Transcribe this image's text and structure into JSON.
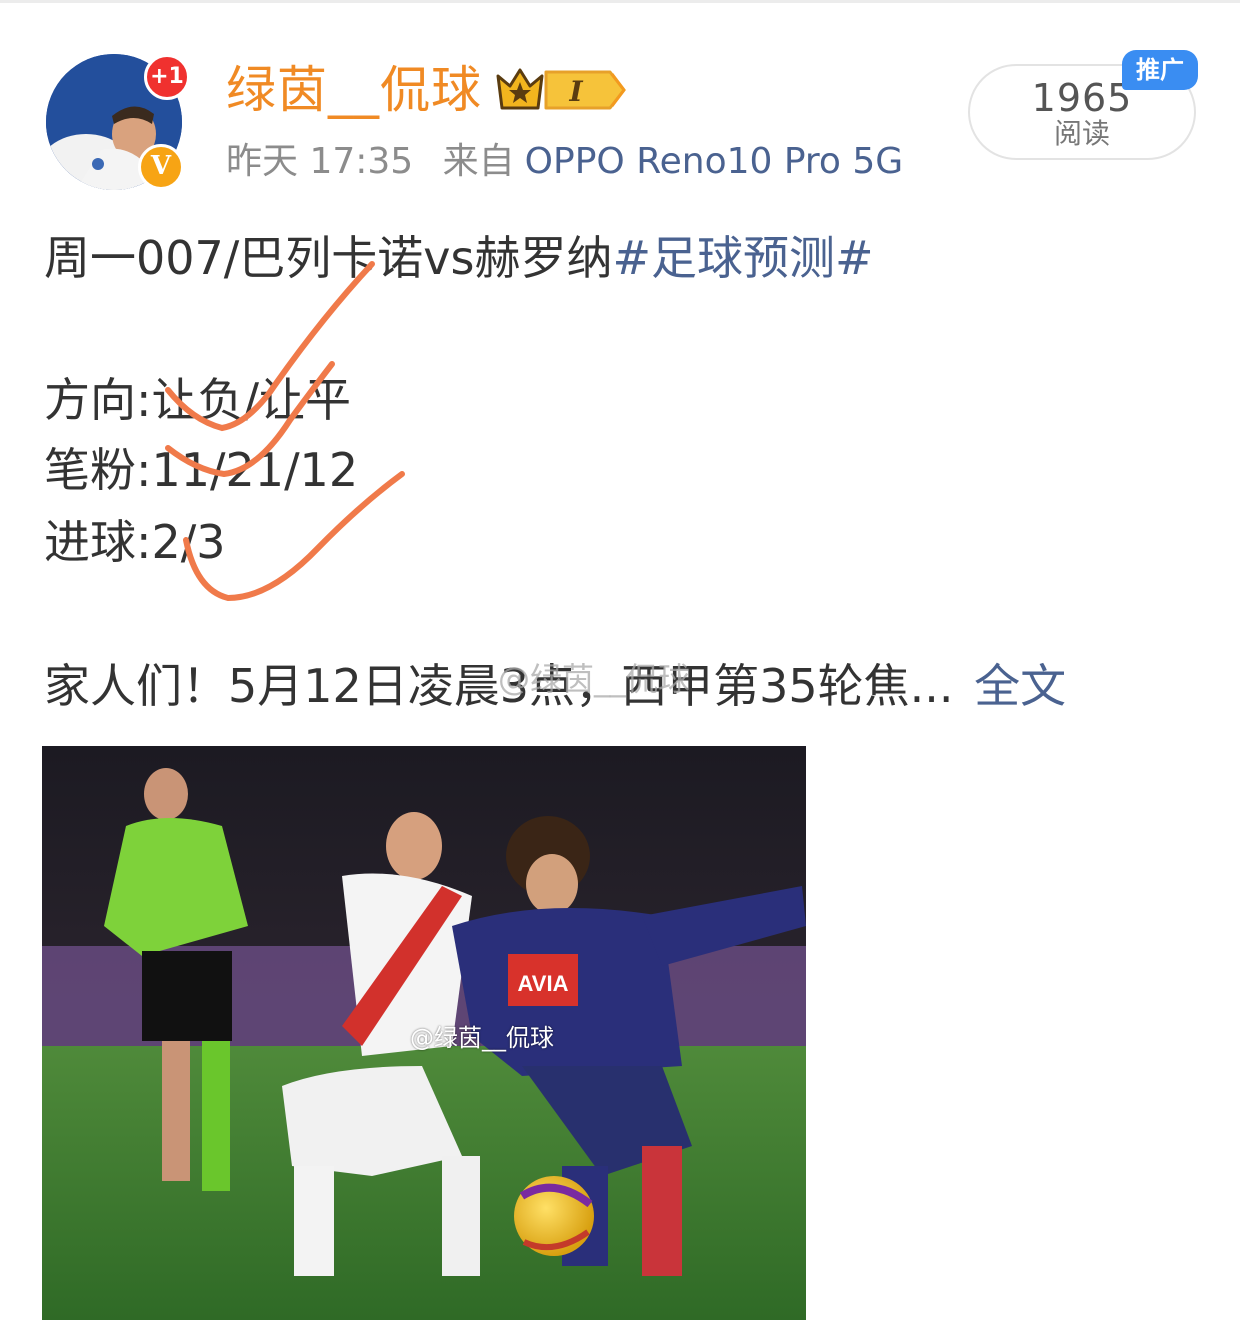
{
  "post": {
    "username": "绿茵__侃球",
    "level_badge": "I",
    "new_count_badge": "+1",
    "verified_badge": "V",
    "time": "昨天 17:35",
    "source_prefix": "来自",
    "source_device": "OPPO Reno10 Pro 5G",
    "reads_count": "1965",
    "reads_label": "阅读",
    "promo_tag": "推广"
  },
  "content": {
    "match_line": "周一007/巴列卡诺vs赫罗纳",
    "hashtag": "#足球预测#",
    "direction_line": "方向:让负/让平",
    "scores_line": "笔粉:11/21/12",
    "goals_line": "进球:2/3",
    "excerpt": "家人们！5月12日凌晨3点，西甲第35轮焦...",
    "full_text_link": "全文",
    "text_watermark": "@绿茵__侃球"
  },
  "image": {
    "watermark": "@绿茵__侃球"
  },
  "icons": {
    "level": "crown-icon",
    "verified": "verified-v-icon",
    "check_marks": "hand-drawn-check-icon"
  },
  "colors": {
    "username": "#f08a24",
    "link": "#4a6290",
    "check_marks": "#f07a4a",
    "promo": "#3a8df2",
    "new_badge": "#f0312f",
    "verified": "#f7a414"
  }
}
